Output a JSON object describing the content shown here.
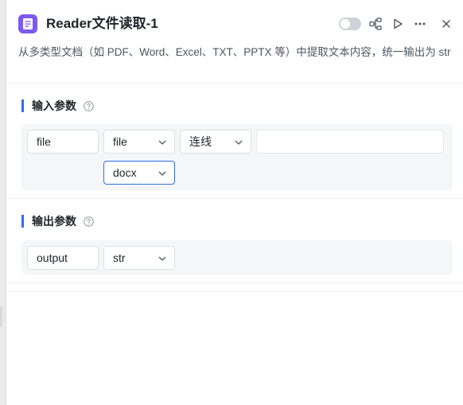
{
  "header": {
    "title": "Reader文件读取-1",
    "description": "从多类型文档（如 PDF、Word、Excel、TXT、PPTX 等）中提取文本内容，统一输出为 str",
    "icons": [
      "document-icon",
      "toggle-switch",
      "flow-icon",
      "play-icon",
      "more-icon",
      "close-icon"
    ]
  },
  "inputs": {
    "title": "输入参数",
    "rows": [
      {
        "name": "file",
        "type": "file",
        "source": "连线",
        "value": ""
      },
      {
        "format": "docx"
      }
    ]
  },
  "outputs": {
    "title": "输出参数",
    "rows": [
      {
        "name": "output",
        "type": "str"
      }
    ]
  },
  "colors": {
    "accent": "#2f6ee9",
    "app_icon": "#7e59f0"
  }
}
